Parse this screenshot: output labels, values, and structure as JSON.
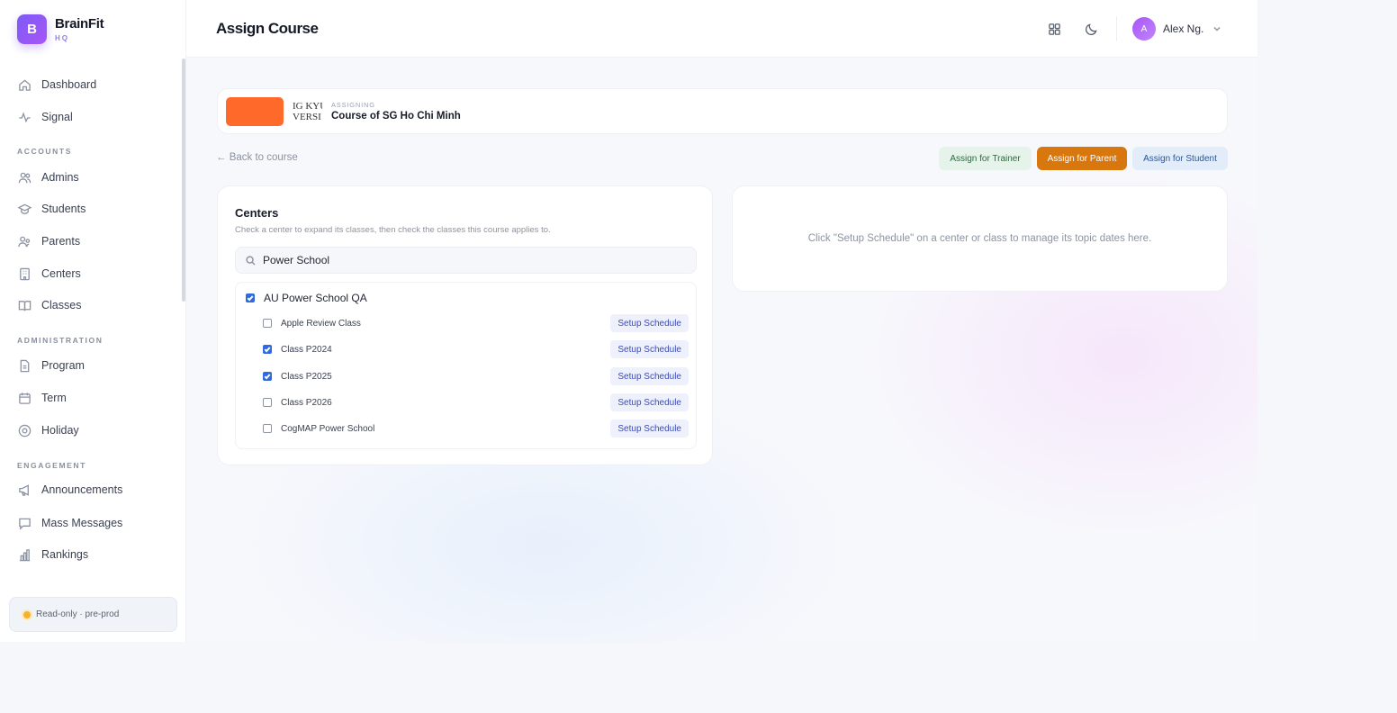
{
  "brand": {
    "logo_letter": "B",
    "name": "BrainFit",
    "sub": "HQ"
  },
  "sidebar": {
    "items": [
      {
        "label": "Dashboard",
        "icon": "home-icon"
      },
      {
        "label": "Signal",
        "icon": "signal-icon"
      }
    ],
    "sections": [
      {
        "title": "ACCOUNTS",
        "items": [
          {
            "label": "Admins",
            "icon": "admins-icon"
          },
          {
            "label": "Students",
            "icon": "graduation-cap-icon"
          },
          {
            "label": "Parents",
            "icon": "parents-icon"
          },
          {
            "label": "Centers",
            "icon": "building-icon"
          },
          {
            "label": "Classes",
            "icon": "book-icon"
          }
        ]
      },
      {
        "title": "ADMINISTRATION",
        "items": [
          {
            "label": "Program",
            "icon": "document-icon"
          },
          {
            "label": "Term",
            "icon": "calendar-icon"
          },
          {
            "label": "Holiday",
            "icon": "holiday-icon"
          }
        ]
      },
      {
        "title": "ENGAGEMENT",
        "items": [
          {
            "label": "Announcements",
            "icon": "megaphone-icon"
          },
          {
            "label": "Mass Messages",
            "icon": "message-icon"
          },
          {
            "label": "Rankings",
            "icon": "bar-chart-icon"
          }
        ]
      }
    ],
    "env_badge": "Read-only · pre-prod"
  },
  "header": {
    "title": "Assign Course",
    "user": {
      "initial": "A",
      "name": "Alex Ng."
    }
  },
  "assigning": {
    "label": "ASSIGNING",
    "course": "Course of SG Ho Chi Minh",
    "thumb_text_1": "IG KYU",
    "thumb_text_2": "VERSI"
  },
  "back_link": "← Back to course",
  "buttons": {
    "trainer": "Assign for Trainer",
    "parent": "Assign for Parent",
    "student": "Assign for Student"
  },
  "centers": {
    "title": "Centers",
    "description": "Check a center to expand its classes, then check the classes this course applies to.",
    "search_value": "Power School",
    "center": {
      "name": "AU Power School QA",
      "checked": true
    },
    "setup_label": "Setup Schedule",
    "classes": [
      {
        "name": "Apple Review Class",
        "checked": false
      },
      {
        "name": "Class P2024",
        "checked": true
      },
      {
        "name": "Class P2025",
        "checked": true
      },
      {
        "name": "Class P2026",
        "checked": false
      },
      {
        "name": "CogMAP Power School",
        "checked": false
      }
    ]
  },
  "schedule": {
    "hint": "Click \"Setup Schedule\" on a center or class to manage its topic dates here."
  },
  "colors": {
    "accent": "#7b5cf5",
    "parent_button": "#d9770f",
    "thumb": "#ff6a2a",
    "checkbox": "#2f6ae0"
  }
}
